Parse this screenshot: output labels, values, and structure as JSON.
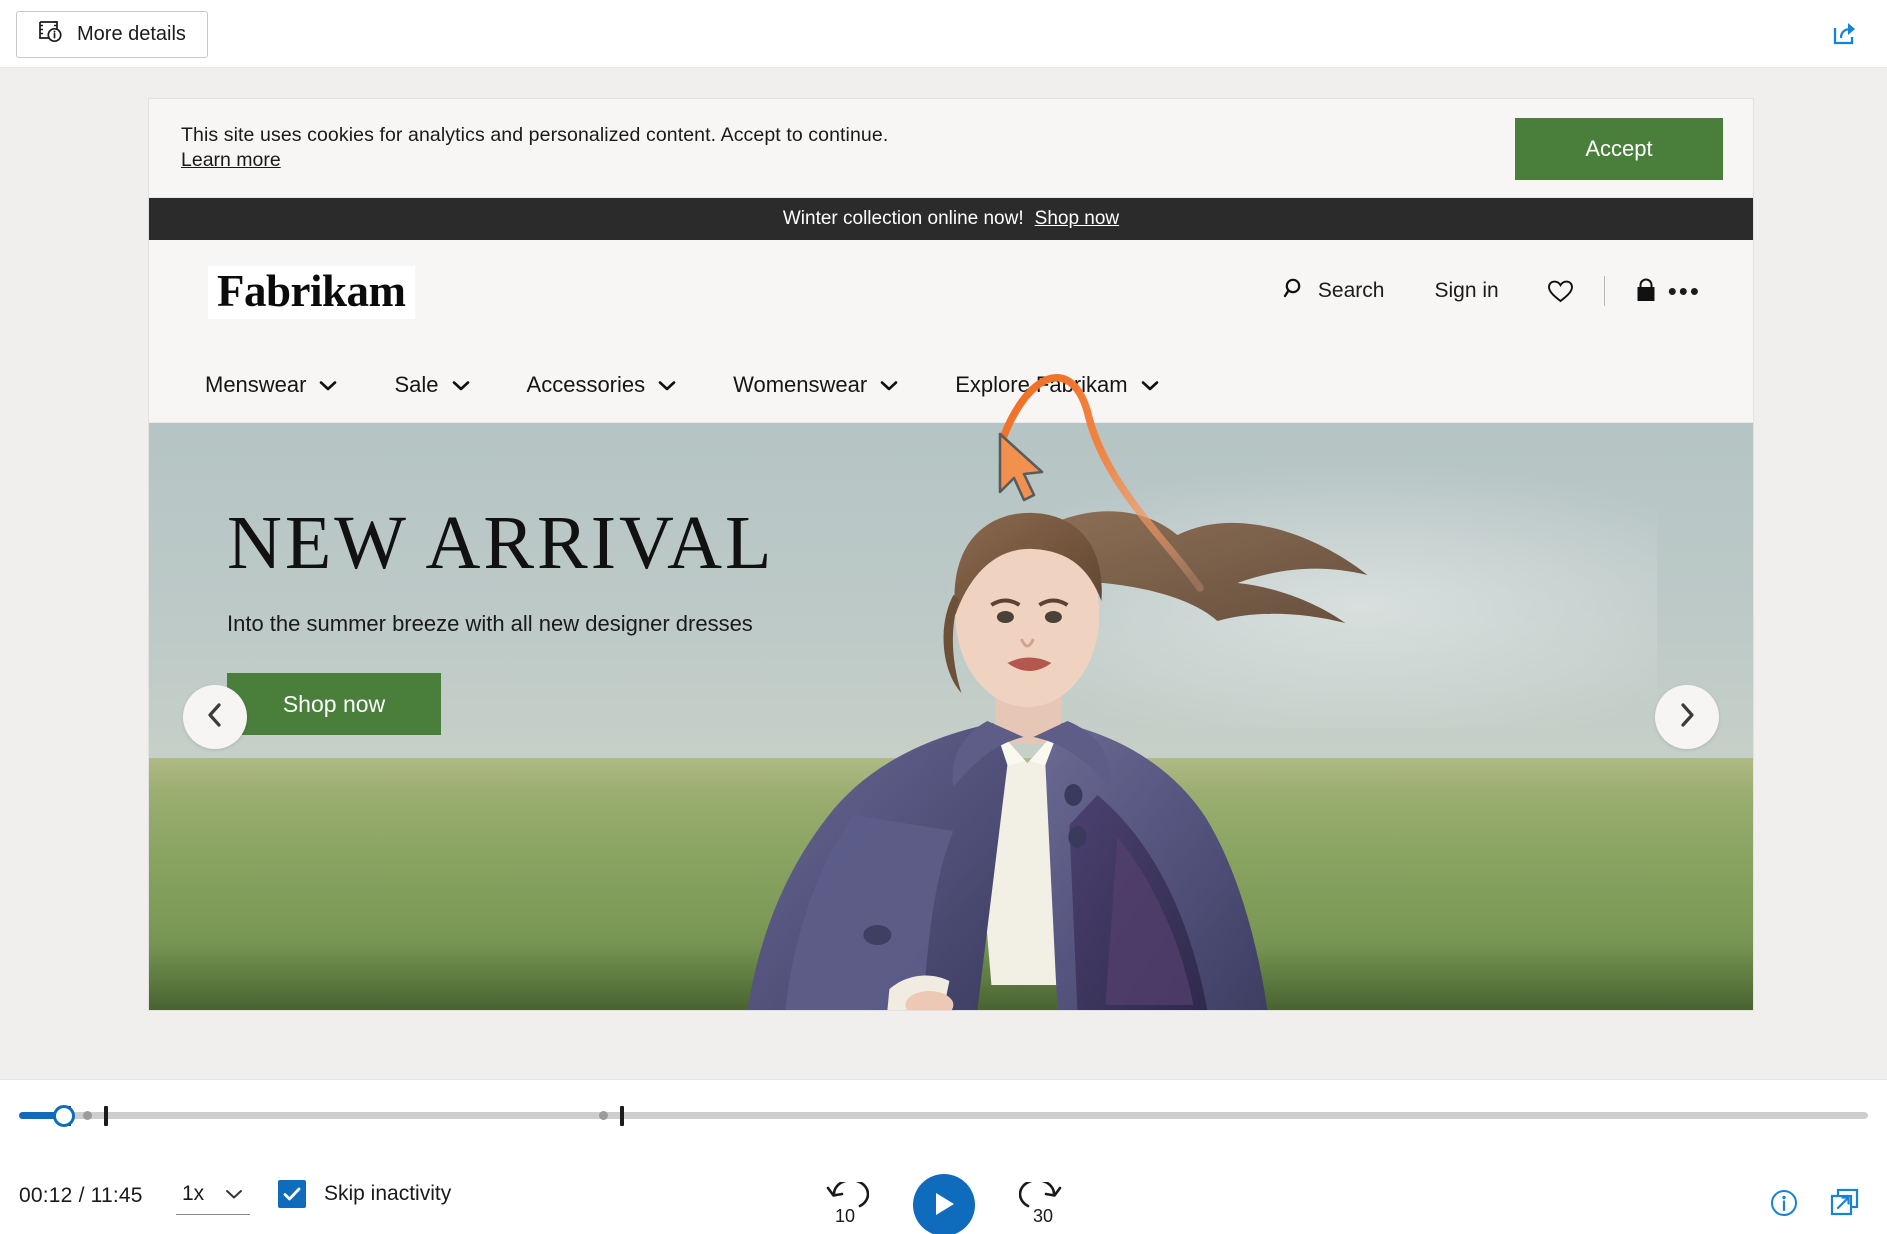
{
  "topbar": {
    "more_details_label": "More details",
    "more_details_icon": "video-details-icon",
    "share_icon": "share-icon"
  },
  "cookie_banner": {
    "message": "This site uses cookies for analytics and personalized content. Accept to continue.",
    "learn_more_label": "Learn more",
    "accept_label": "Accept",
    "accept_color": "#4a7f3b",
    "background": "#f7f6f4"
  },
  "promo": {
    "message": "Winter collection online now!",
    "link_label": "Shop now",
    "background": "#2b2b2b"
  },
  "site_header": {
    "logo_text": "Fabrikam",
    "actions": {
      "search_label": "Search",
      "search_icon": "search-icon",
      "signin_label": "Sign in",
      "wishlist_icon": "heart-icon",
      "cart_icon": "shopping-bag-icon",
      "overflow_icon": "ellipsis-icon",
      "overflow_label": "•••"
    }
  },
  "nav": {
    "items": [
      {
        "label": "Menswear",
        "icon": "chevron-down-icon"
      },
      {
        "label": "Sale",
        "icon": "chevron-down-icon"
      },
      {
        "label": "Accessories",
        "icon": "chevron-down-icon"
      },
      {
        "label": "Womenswear",
        "icon": "chevron-down-icon"
      },
      {
        "label": "Explore Fabrikam",
        "icon": "chevron-down-icon"
      }
    ]
  },
  "hero": {
    "title": "NEW ARRIVAL",
    "subtitle": "Into the summer breeze with all new designer dresses",
    "cta_label": "Shop now",
    "cta_color": "#4a7f3b",
    "prev_icon": "chevron-left-icon",
    "next_icon": "chevron-right-icon",
    "sky_color": "#b8c7c5",
    "grass_color": "#8aa462",
    "coat_color": "#5a5a82"
  },
  "annotation": {
    "type": "cursor-path-arc",
    "color": "#f0763a",
    "cursor_icon": "mouse-pointer-icon",
    "target": "Explore Fabrikam"
  },
  "player": {
    "current_time": "00:12",
    "total_time": "11:45",
    "time_display": "00:12 / 11:45",
    "speed_label": "1x",
    "speed_icon": "chevron-down-icon",
    "skip_inactivity_label": "Skip inactivity",
    "skip_inactivity_checked": true,
    "checkbox_color": "#0f6cbd",
    "rewind_label": "10",
    "rewind_icon": "rewind-10-icon",
    "play_icon": "play-icon",
    "forward_label": "30",
    "forward_icon": "forward-30-icon",
    "progress_percent": 1.8,
    "accent_color": "#0f6cbd",
    "info_icon": "info-icon",
    "popout_icon": "pop-out-icon",
    "markers": [
      {
        "type": "tick",
        "position_percent": 2.1
      },
      {
        "type": "tick",
        "position_percent": 2.45
      },
      {
        "type": "dot",
        "position_percent": 3.3
      },
      {
        "type": "tick",
        "position_percent": 4.4
      },
      {
        "type": "dot",
        "position_percent": 26.0
      },
      {
        "type": "tick",
        "position_percent": 27.0
      }
    ]
  }
}
